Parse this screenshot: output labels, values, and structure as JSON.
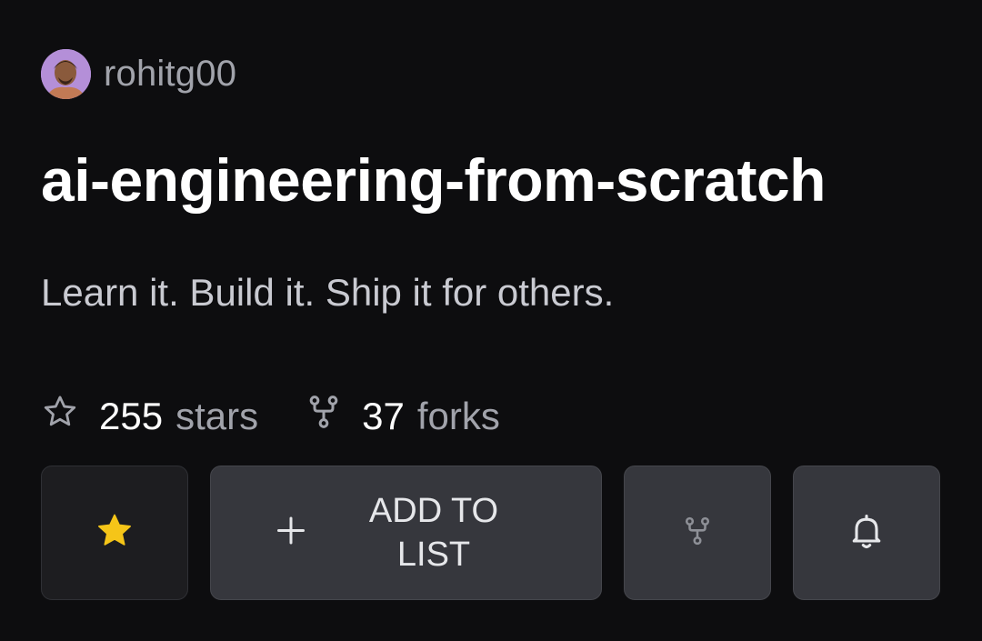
{
  "owner": {
    "username": "rohitg00",
    "avatar_icon": "user-avatar-photo"
  },
  "repo": {
    "name": "ai-engineering-from-scratch",
    "description": "Learn it. Build it. Ship it for others."
  },
  "stats": {
    "stars_count": "255",
    "stars_label": "stars",
    "forks_count": "37",
    "forks_label": "forks",
    "star_icon": "star-outline-icon",
    "fork_icon": "fork-icon"
  },
  "actions": {
    "star_icon": "star-filled-icon",
    "add_to_list_icon": "plus-icon",
    "add_to_list_label": "ADD TO LIST",
    "fork_icon": "fork-icon",
    "notifications_icon": "bell-icon"
  },
  "colors": {
    "background": "#0d0d0f",
    "star_accent": "#f5c518",
    "muted_text": "#a1a3ab",
    "button_bg": "#36373d"
  }
}
